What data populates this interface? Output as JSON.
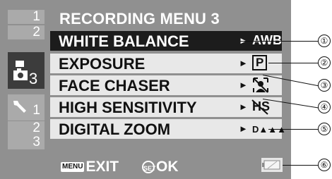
{
  "tabs": {
    "recording_nums": [
      "1",
      "2"
    ],
    "active_num": "3",
    "setup_nums": [
      "1",
      "2",
      "3"
    ]
  },
  "menu": {
    "title": "RECORDING MENU 3",
    "items": [
      {
        "label": "WHITE BALANCE",
        "arrow": "►",
        "value": "AWB"
      },
      {
        "label": "EXPOSURE",
        "arrow": "►",
        "value": "P"
      },
      {
        "label": "FACE CHASER",
        "arrow": "►",
        "value": ""
      },
      {
        "label": "HIGH SENSITIVITY",
        "arrow": "►",
        "value": "HS"
      },
      {
        "label": "DIGITAL ZOOM",
        "arrow": "►",
        "value": "D▲▲▲"
      }
    ]
  },
  "footer": {
    "menu_key": "MENU",
    "exit_label": "EXIT",
    "set_key": "SET",
    "ok_label": "OK"
  },
  "callouts": [
    "①",
    "②",
    "③",
    "④",
    "⑤",
    "⑥"
  ],
  "colors": {
    "screen": "#909090",
    "row": "#e8e8e8",
    "selected": "#1c1c1c",
    "tab": "#aaaaaa"
  }
}
